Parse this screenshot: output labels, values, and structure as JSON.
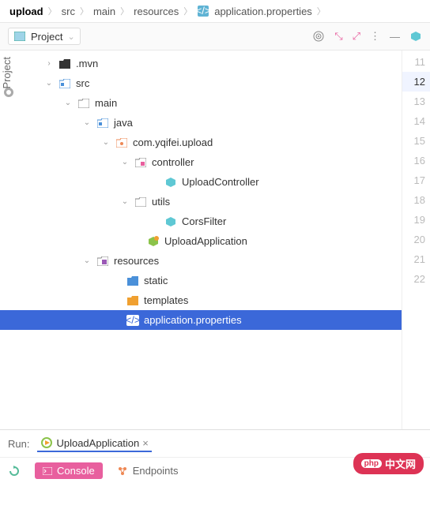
{
  "breadcrumb": {
    "root": "upload",
    "items": [
      "src",
      "main",
      "resources",
      "application.properties"
    ]
  },
  "toolbar": {
    "project_label": "Project"
  },
  "sidebar": {
    "tab_label": "Project"
  },
  "tree": {
    "items": [
      {
        "indent": 56,
        "arrow": ">",
        "icon": "folder-dark",
        "label": ".mvn"
      },
      {
        "indent": 56,
        "arrow": "v",
        "icon": "folder-blue",
        "label": "src"
      },
      {
        "indent": 80,
        "arrow": "v",
        "icon": "folder-outline",
        "label": "main"
      },
      {
        "indent": 104,
        "arrow": "v",
        "icon": "folder-blue",
        "label": "java"
      },
      {
        "indent": 128,
        "arrow": "v",
        "icon": "folder-orange",
        "label": "com.yqifei.upload"
      },
      {
        "indent": 152,
        "arrow": "v",
        "icon": "folder-pink",
        "label": "controller"
      },
      {
        "indent": 190,
        "arrow": "",
        "icon": "class-file",
        "label": "UploadController"
      },
      {
        "indent": 152,
        "arrow": "v",
        "icon": "folder-outline",
        "label": "utils"
      },
      {
        "indent": 190,
        "arrow": "",
        "icon": "class-file",
        "label": "CorsFilter"
      },
      {
        "indent": 168,
        "arrow": "",
        "icon": "spring-app",
        "label": "UploadApplication"
      },
      {
        "indent": 104,
        "arrow": "v",
        "icon": "folder-purple",
        "label": "resources"
      },
      {
        "indent": 142,
        "arrow": "",
        "icon": "folder-static",
        "label": "static"
      },
      {
        "indent": 142,
        "arrow": "",
        "icon": "folder-templates",
        "label": "templates"
      },
      {
        "indent": 142,
        "arrow": "",
        "icon": "props-file",
        "label": "application.properties",
        "selected": true
      }
    ]
  },
  "gutter": {
    "lines": [
      "11",
      "12",
      "13",
      "14",
      "15",
      "16",
      "17",
      "18",
      "19",
      "20",
      "21",
      "22"
    ],
    "current": "12"
  },
  "run": {
    "label": "Run:",
    "tab": "UploadApplication"
  },
  "bottom": {
    "console": "Console",
    "endpoints": "Endpoints"
  },
  "watermark": {
    "php": "php",
    "text": "中文网"
  }
}
